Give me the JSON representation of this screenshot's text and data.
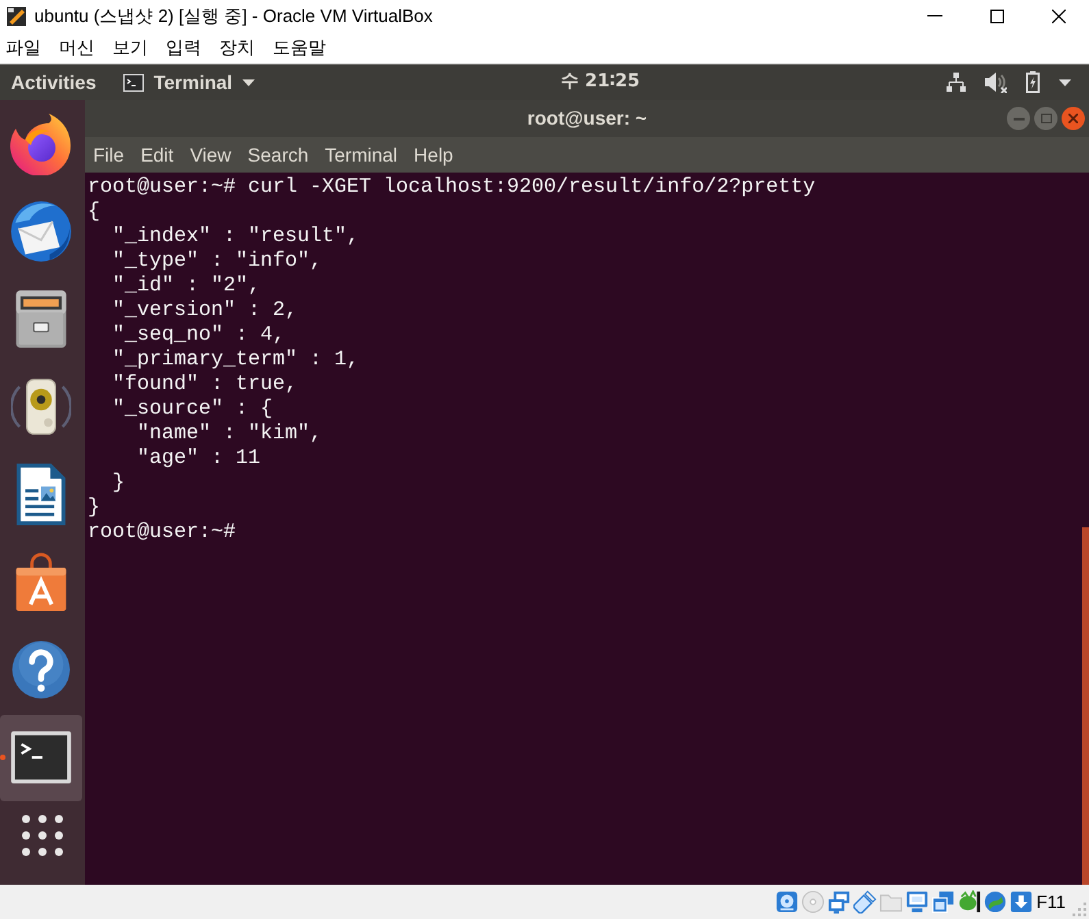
{
  "vbox_window": {
    "title": "ubuntu (스냅샷 2) [실행 중] - Oracle VM VirtualBox",
    "menu": [
      "파일",
      "머신",
      "보기",
      "입력",
      "장치",
      "도움말"
    ]
  },
  "top_bar": {
    "activities": "Activities",
    "app_menu": "Terminal",
    "clock": "수 21∶25",
    "sound_muted": true
  },
  "dock": {
    "items": [
      {
        "kind": "browser",
        "active": false
      },
      {
        "kind": "mail",
        "active": false
      },
      {
        "kind": "files",
        "active": false
      },
      {
        "kind": "music",
        "active": false
      },
      {
        "kind": "writer",
        "active": false
      },
      {
        "kind": "software",
        "active": false
      },
      {
        "kind": "help",
        "active": false
      },
      {
        "kind": "terminal",
        "active": true
      }
    ]
  },
  "terminal": {
    "title": "root@user: ~",
    "menu": [
      "File",
      "Edit",
      "View",
      "Search",
      "Terminal",
      "Help"
    ],
    "lines": [
      "root@user:~# curl -XGET localhost:9200/result/info/2?pretty",
      "{",
      "  \"_index\" : \"result\",",
      "  \"_type\" : \"info\",",
      "  \"_id\" : \"2\",",
      "  \"_version\" : 2,",
      "  \"_seq_no\" : 4,",
      "  \"_primary_term\" : 1,",
      "  \"found\" : true,",
      "  \"_source\" : {",
      "    \"name\" : \"kim\",",
      "    \"age\" : 11",
      "  }",
      "}",
      "root@user:~#"
    ]
  },
  "status_bar": {
    "indicators": [
      {
        "kind": "hard-disk",
        "active": true
      },
      {
        "kind": "optical",
        "active": false
      },
      {
        "kind": "network",
        "active": true
      },
      {
        "kind": "usb",
        "active": true
      },
      {
        "kind": "shared-folder",
        "active": false
      },
      {
        "kind": "display",
        "active": true
      },
      {
        "kind": "capture",
        "active": true
      },
      {
        "kind": "mouse",
        "active": true
      },
      {
        "kind": "guest",
        "active": true
      },
      {
        "kind": "keyboard",
        "active": true
      }
    ],
    "host_key": "F11"
  }
}
